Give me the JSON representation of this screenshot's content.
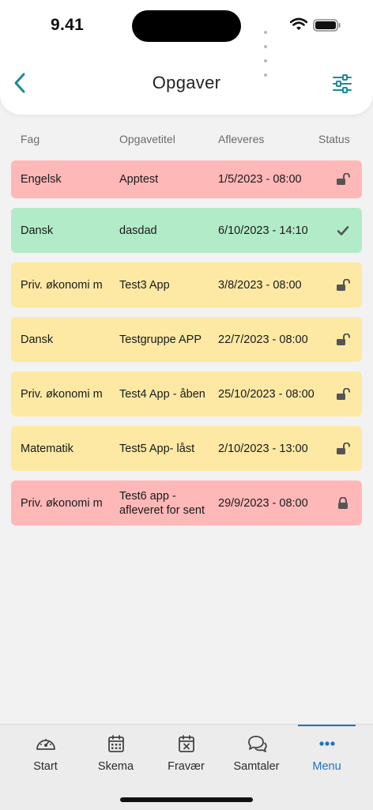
{
  "status_bar": {
    "time": "9.41"
  },
  "header": {
    "title": "Opgaver"
  },
  "columns": {
    "fag": "Fag",
    "titel": "Opgavetitel",
    "afleveres": "Afleveres",
    "status": "Status"
  },
  "colors": {
    "red": "#ffb8b8",
    "green": "#b2ebc8",
    "yellow": "#fde9a4",
    "accent": "#1e73be",
    "teal": "#1a8a9a"
  },
  "rows": [
    {
      "fag": "Engelsk",
      "titel": "Apptest",
      "afleveres": "1/5/2023 - 08:00",
      "color": "red",
      "status_icon": "unlocked-icon"
    },
    {
      "fag": "Dansk",
      "titel": "dasdad",
      "afleveres": "6/10/2023 - 14:10",
      "color": "green",
      "status_icon": "check-icon"
    },
    {
      "fag": "Priv. økonomi m",
      "titel": "Test3 App",
      "afleveres": "3/8/2023 - 08:00",
      "color": "yellow",
      "status_icon": "unlocked-icon"
    },
    {
      "fag": "Dansk",
      "titel": "Testgruppe APP",
      "afleveres": "22/7/2023 - 08:00",
      "color": "yellow",
      "status_icon": "unlocked-icon"
    },
    {
      "fag": "Priv. økonomi m",
      "titel": "Test4 App - åben",
      "afleveres": "25/10/2023 - 08:00",
      "color": "yellow",
      "status_icon": "unlocked-icon"
    },
    {
      "fag": "Matematik",
      "titel": "Test5 App- låst",
      "afleveres": "2/10/2023 - 13:00",
      "color": "yellow",
      "status_icon": "unlocked-icon"
    },
    {
      "fag": "Priv. økonomi m",
      "titel": "Test6 app - afleveret for sent",
      "afleveres": "29/9/2023 - 08:00",
      "color": "red",
      "status_icon": "locked-icon"
    }
  ],
  "tabbar": {
    "items": [
      {
        "label": "Start",
        "icon": "dashboard-icon"
      },
      {
        "label": "Skema",
        "icon": "calendar-icon"
      },
      {
        "label": "Fravær",
        "icon": "calendar-x-icon"
      },
      {
        "label": "Samtaler",
        "icon": "chat-icon"
      },
      {
        "label": "Menu",
        "icon": "more-icon",
        "active": true
      }
    ]
  }
}
